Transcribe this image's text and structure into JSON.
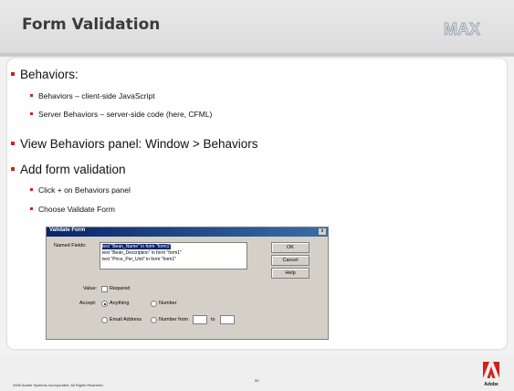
{
  "slide": {
    "title": "Form Validation",
    "logo_text": "MAX",
    "bullets": [
      {
        "text": "Behaviors:",
        "children": [
          "Behaviors – client-side JavaScript",
          "Server Behaviors – server-side code (here, CFML)"
        ]
      },
      {
        "text": "View Behaviors panel: Window > Behaviors",
        "children": []
      },
      {
        "text": "Add form validation",
        "children": [
          "Click + on Behaviors panel",
          "Choose Validate Form"
        ]
      }
    ],
    "footer": {
      "copyright": "2006 Adobe Systems Incorporated.  All Rights Reserved.",
      "page_number": "55",
      "brand": "Adobe"
    }
  },
  "dialog": {
    "title": "Validate Form",
    "close_label": "x",
    "named_fields_label": "Named Fields:",
    "fields": [
      "text \"Bean_Name\" in form \"form1\"",
      "text \"Bean_Description\" in form \"form1\"",
      "text \"Price_Per_Unit\" in form \"form1\""
    ],
    "selected_field": 0,
    "value_label": "Value:",
    "required_label": "Required",
    "required_checked": false,
    "accept_label": "Accept:",
    "accept_options": [
      "Anything",
      "Number",
      "Email Address",
      "Number from"
    ],
    "accept_selected": 0,
    "to_label": "to",
    "buttons": {
      "ok": "OK",
      "cancel": "Cancel",
      "help": "Help"
    }
  }
}
